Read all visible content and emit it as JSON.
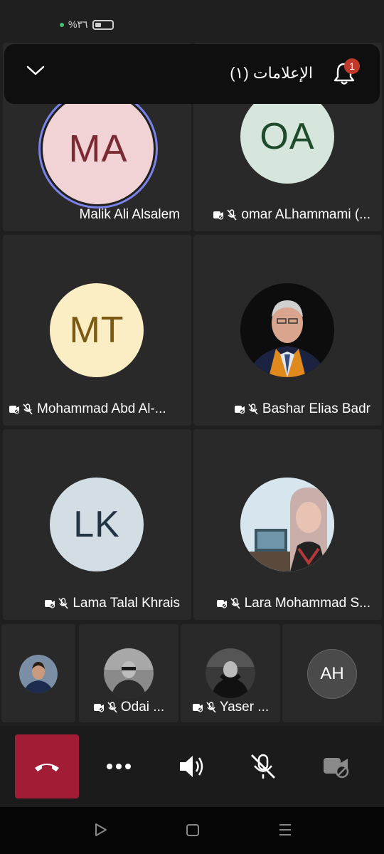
{
  "status_bar": {
    "battery_text": "%٣٦"
  },
  "notification": {
    "label": "الإعلامات (١)",
    "badge": "1"
  },
  "participants": [
    {
      "initials": "MA",
      "name": "Malik Ali Alsalem",
      "avatar_bg": "#f2d3d5",
      "avatar_fg": "#7a2a33",
      "speaking": true
    },
    {
      "initials": "OA",
      "name": "omar ALhammami (...",
      "avatar_bg": "#d6e6dc",
      "avatar_fg": "#1f4a2c"
    },
    {
      "initials": "MT",
      "name": "Mohammad Abd Al-...",
      "avatar_bg": "#fbeec4",
      "avatar_fg": "#7a5a12"
    },
    {
      "initials": "",
      "name": "Bashar Elias Badr"
    },
    {
      "initials": "LK",
      "name": "Lama Talal Khrais",
      "avatar_bg": "#d3dde4",
      "avatar_fg": "#223344"
    },
    {
      "initials": "",
      "name": "Lara Mohammad S..."
    }
  ],
  "small_participants": [
    {
      "name": ""
    },
    {
      "name": "Odai ..."
    },
    {
      "name": "Yaser ..."
    },
    {
      "initials": "AH",
      "name": ""
    }
  ]
}
